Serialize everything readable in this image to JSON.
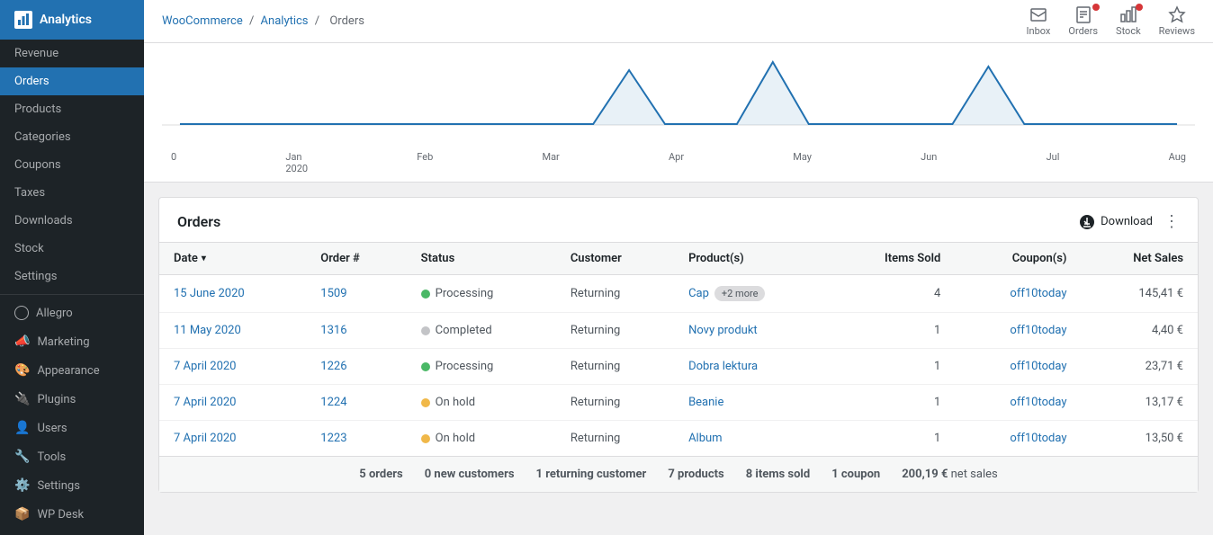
{
  "sidebar": {
    "logo": {
      "label": "Analytics"
    },
    "items": [
      {
        "id": "revenue",
        "label": "Revenue",
        "active": false
      },
      {
        "id": "orders",
        "label": "Orders",
        "active": true
      },
      {
        "id": "products",
        "label": "Products",
        "active": false
      },
      {
        "id": "categories",
        "label": "Categories",
        "active": false
      },
      {
        "id": "coupons",
        "label": "Coupons",
        "active": false
      },
      {
        "id": "taxes",
        "label": "Taxes",
        "active": false
      },
      {
        "id": "downloads",
        "label": "Downloads",
        "active": false
      },
      {
        "id": "stock",
        "label": "Stock",
        "active": false
      },
      {
        "id": "settings",
        "label": "Settings",
        "active": false
      },
      {
        "id": "allegro",
        "label": "Allegro",
        "active": false
      },
      {
        "id": "marketing",
        "label": "Marketing",
        "active": false
      },
      {
        "id": "appearance",
        "label": "Appearance",
        "active": false
      },
      {
        "id": "plugins",
        "label": "Plugins",
        "active": false
      },
      {
        "id": "users",
        "label": "Users",
        "active": false
      },
      {
        "id": "tools",
        "label": "Tools",
        "active": false
      },
      {
        "id": "settings2",
        "label": "Settings",
        "active": false
      },
      {
        "id": "wpdesk",
        "label": "WP Desk",
        "active": false
      }
    ]
  },
  "toolbar": {
    "breadcrumb": {
      "woocommerce": "WooCommerce",
      "analytics": "Analytics",
      "orders": "Orders"
    },
    "icons": [
      {
        "id": "inbox",
        "label": "Inbox",
        "badge": null
      },
      {
        "id": "orders",
        "label": "Orders",
        "badge": "●"
      },
      {
        "id": "stock",
        "label": "Stock",
        "badge": "●"
      },
      {
        "id": "reviews",
        "label": "Reviews",
        "badge": null
      }
    ]
  },
  "chart": {
    "x_labels": [
      "0",
      "Jan\n2020",
      "Feb",
      "Mar",
      "Apr",
      "May",
      "Jun",
      "Jul",
      "Aug"
    ]
  },
  "orders_panel": {
    "title": "Orders",
    "download_label": "Download",
    "columns": {
      "date": "Date",
      "order_num": "Order #",
      "status": "Status",
      "customer": "Customer",
      "products": "Product(s)",
      "items_sold": "Items Sold",
      "coupons": "Coupon(s)",
      "net_sales": "Net Sales"
    },
    "rows": [
      {
        "date": "15 June 2020",
        "order_num": "1509",
        "status": "Processing",
        "status_type": "processing",
        "customer": "Returning",
        "products": [
          "Cap"
        ],
        "more": "+2 more",
        "items_sold": "4",
        "coupon": "off10today",
        "net_sales": "145,41 €"
      },
      {
        "date": "11 May 2020",
        "order_num": "1316",
        "status": "Completed",
        "status_type": "completed",
        "customer": "Returning",
        "products": [
          "Novy produkt"
        ],
        "more": null,
        "items_sold": "1",
        "coupon": "off10today",
        "net_sales": "4,40 €"
      },
      {
        "date": "7 April 2020",
        "order_num": "1226",
        "status": "Processing",
        "status_type": "processing",
        "customer": "Returning",
        "products": [
          "Dobra lektura"
        ],
        "more": null,
        "items_sold": "1",
        "coupon": "off10today",
        "net_sales": "23,71 €"
      },
      {
        "date": "7 April 2020",
        "order_num": "1224",
        "status": "On hold",
        "status_type": "on-hold",
        "customer": "Returning",
        "products": [
          "Beanie"
        ],
        "more": null,
        "items_sold": "1",
        "coupon": "off10today",
        "net_sales": "13,17 €"
      },
      {
        "date": "7 April 2020",
        "order_num": "1223",
        "status": "On hold",
        "status_type": "on-hold",
        "customer": "Returning",
        "products": [
          "Album"
        ],
        "more": null,
        "items_sold": "1",
        "coupon": "off10today",
        "net_sales": "13,50 €"
      }
    ],
    "summary": [
      {
        "value": "5 orders",
        "label": ""
      },
      {
        "value": "0 new customers",
        "label": ""
      },
      {
        "value": "1 returning customer",
        "label": ""
      },
      {
        "value": "7 products",
        "label": ""
      },
      {
        "value": "8 items sold",
        "label": ""
      },
      {
        "value": "1 coupon",
        "label": ""
      },
      {
        "value": "200,19 €",
        "label": "net sales"
      }
    ]
  },
  "colors": {
    "accent": "#2271b1",
    "sidebar_bg": "#1d2327",
    "sidebar_active": "#2271b1",
    "processing": "#4ab866",
    "completed": "#c3c4c7",
    "on_hold": "#f0b849"
  }
}
